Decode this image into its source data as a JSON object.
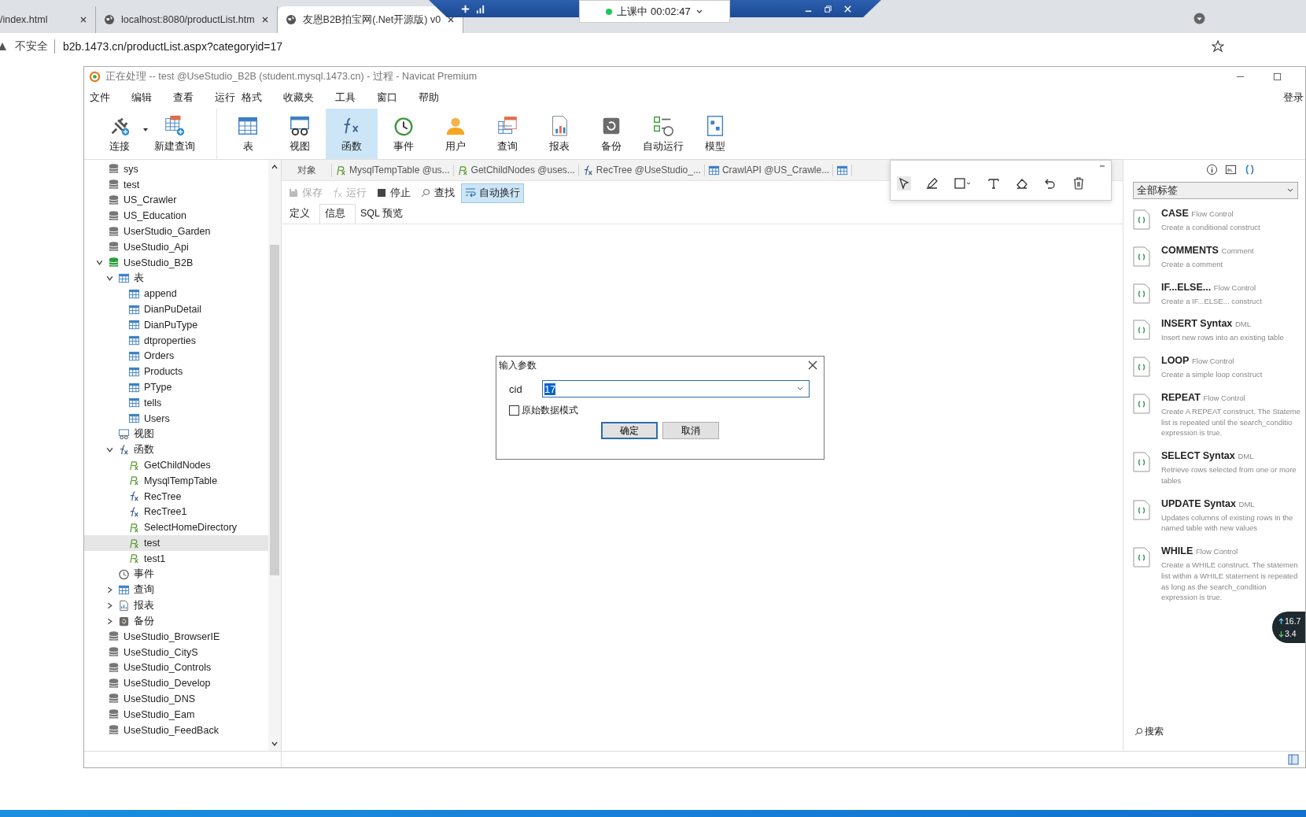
{
  "browser": {
    "tabs": [
      {
        "title": "/index.html",
        "selected": false
      },
      {
        "title": "localhost:8080/productList.htm",
        "selected": false
      },
      {
        "title": "友恩B2B拍宝网(.Net开源版) v0",
        "selected": true
      }
    ],
    "security": "不安全",
    "url": "b2b.1473.cn/productList.aspx?categoryid=17"
  },
  "remote_bar": {
    "status": "上课中 00:02:47"
  },
  "app": {
    "title": "正在处理 -- test @UseStudio_B2B (student.mysql.1473.cn) - 过程 - Navicat Premium",
    "menu": [
      "文件",
      "编辑",
      "查看",
      "运行",
      "格式",
      "收藏夹",
      "工具",
      "窗口",
      "帮助"
    ],
    "login": "登录",
    "toolbar": [
      {
        "kind": "connect",
        "label": "连接",
        "selected": false
      },
      {
        "kind": "newquery",
        "label": "新建查询",
        "selected": false
      },
      {
        "kind": "table",
        "label": "表",
        "selected": false
      },
      {
        "kind": "view",
        "label": "视图",
        "selected": false
      },
      {
        "kind": "function",
        "label": "函数",
        "selected": true
      },
      {
        "kind": "event",
        "label": "事件",
        "selected": false
      },
      {
        "kind": "user",
        "label": "用户",
        "selected": false
      },
      {
        "kind": "query",
        "label": "查询",
        "selected": false
      },
      {
        "kind": "report",
        "label": "报表",
        "selected": false
      },
      {
        "kind": "backup",
        "label": "备份",
        "selected": false
      },
      {
        "kind": "schedule",
        "label": "自动运行",
        "selected": false
      },
      {
        "kind": "model",
        "label": "模型",
        "selected": false
      }
    ]
  },
  "tree": [
    {
      "kind": "database",
      "label": "sys"
    },
    {
      "kind": "database",
      "label": "test"
    },
    {
      "kind": "database",
      "label": "US_Crawler"
    },
    {
      "kind": "database",
      "label": "US_Education"
    },
    {
      "kind": "database",
      "label": "UserStudio_Garden"
    },
    {
      "kind": "database",
      "label": "UseStudio_Api"
    },
    {
      "kind": "database_open",
      "label": "UseStudio_B2B",
      "expanded": true,
      "children": [
        {
          "kind": "table",
          "label": "表",
          "expanded": true,
          "children": [
            {
              "kind": "table",
              "label": "append"
            },
            {
              "kind": "table",
              "label": "DianPuDetail"
            },
            {
              "kind": "table",
              "label": "DianPuType"
            },
            {
              "kind": "table",
              "label": "dtproperties"
            },
            {
              "kind": "table",
              "label": "Orders"
            },
            {
              "kind": "table",
              "label": "Products"
            },
            {
              "kind": "table",
              "label": "PType"
            },
            {
              "kind": "table",
              "label": "tells"
            },
            {
              "kind": "table",
              "label": "Users"
            }
          ]
        },
        {
          "kind": "view",
          "label": "视图"
        },
        {
          "kind": "function",
          "label": "函数",
          "expanded": true,
          "children": [
            {
              "kind": "procedure",
              "label": "GetChildNodes",
              "selected": false
            },
            {
              "kind": "procedure",
              "label": "MysqlTempTable",
              "selected": false
            },
            {
              "kind": "function",
              "label": "RecTree",
              "selected": false
            },
            {
              "kind": "function",
              "label": "RecTree1",
              "selected": false
            },
            {
              "kind": "procedure",
              "label": "SelectHomeDirectory",
              "selected": false
            },
            {
              "kind": "procedure",
              "label": "test",
              "selected": true
            },
            {
              "kind": "procedure",
              "label": "test1",
              "selected": false
            }
          ]
        },
        {
          "kind": "event",
          "label": "事件"
        },
        {
          "kind": "query",
          "label": "查询",
          "expanded": false
        },
        {
          "kind": "report",
          "label": "报表",
          "expanded": false
        },
        {
          "kind": "backup",
          "label": "备份",
          "expanded": false
        }
      ]
    },
    {
      "kind": "database",
      "label": "UseStudio_BrowserIE"
    },
    {
      "kind": "database",
      "label": "UseStudio_CityS"
    },
    {
      "kind": "database",
      "label": "UseStudio_Controls"
    },
    {
      "kind": "database",
      "label": "UseStudio_Develop"
    },
    {
      "kind": "database",
      "label": "UseStudio_DNS"
    },
    {
      "kind": "database",
      "label": "UseStudio_Eam"
    },
    {
      "kind": "database",
      "label": "UseStudio_FeedBack"
    }
  ],
  "editor": {
    "objects_tab": "对象",
    "tabs": [
      {
        "kind": "procedure",
        "label": "MysqlTempTable @us..."
      },
      {
        "kind": "procedure",
        "label": "GetChildNodes @uses..."
      },
      {
        "kind": "function",
        "label": "RecTree @UseStudio_..."
      },
      {
        "kind": "table",
        "label": "CrawlAPI @US_Crawle..."
      }
    ],
    "actions": [
      {
        "kind": "save",
        "label": "保存",
        "disabled": true,
        "on": false
      },
      {
        "kind": "run",
        "label": "运行",
        "disabled": true,
        "on": false
      },
      {
        "kind": "stop",
        "label": "停止",
        "disabled": false,
        "on": false
      },
      {
        "kind": "find",
        "label": "查找",
        "disabled": false,
        "on": false
      },
      {
        "kind": "wrap",
        "label": "自动换行",
        "disabled": false,
        "on": true
      }
    ],
    "subtabs": [
      {
        "label": "定义",
        "selected": false
      },
      {
        "label": "信息",
        "selected": true
      },
      {
        "label": "SQL 预览",
        "selected": false
      }
    ]
  },
  "snippets": {
    "filter": "全部标签",
    "items": [
      {
        "title": "CASE",
        "category": "Flow Control",
        "description": "Create a conditional construct"
      },
      {
        "title": "COMMENTS",
        "category": "Comment",
        "description": "Create a comment"
      },
      {
        "title": "IF...ELSE...",
        "category": "Flow Control",
        "description": "Create a IF...ELSE... construct"
      },
      {
        "title": "INSERT Syntax",
        "category": "DML",
        "description": "Insert new rows into an existing table"
      },
      {
        "title": "LOOP",
        "category": "Flow Control",
        "description": "Create a simple loop construct"
      },
      {
        "title": "REPEAT",
        "category": "Flow Control",
        "description": "Create A REPEAT construct. The Stateme list is repeated until the search_conditio expression is true."
      },
      {
        "title": "SELECT Syntax",
        "category": "DML",
        "description": "Retrieve rows selected from one or more tables"
      },
      {
        "title": "UPDATE Syntax",
        "category": "DML",
        "description": "Updates columns of existing rows in the named table with new values"
      },
      {
        "title": "WHILE",
        "category": "Flow Control",
        "description": "Create a WHILE construct. The statemen list within a WHILE statement is repeated as long as the search_condition expression is true."
      }
    ],
    "search": "搜索"
  },
  "speed": {
    "up": "16.7",
    "down": "3.4"
  },
  "dialog": {
    "title": "输入参数",
    "field_label": "cid",
    "value": "17",
    "raw_mode": {
      "label": "原始数据模式",
      "checked": false
    },
    "buttons": [
      {
        "label": "确定",
        "default": true
      },
      {
        "label": "取消",
        "default": false
      }
    ]
  }
}
